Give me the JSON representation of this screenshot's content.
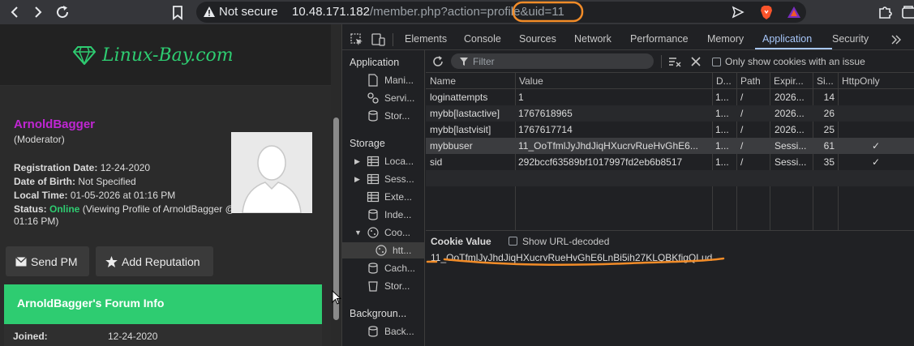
{
  "browser": {
    "not_secure": "Not secure",
    "url_host": "10.48.171.182",
    "url_path": "/member.php?action=profile",
    "url_query": "&uid=11",
    "annotation_color": "#f28c28"
  },
  "site": {
    "logo_text": "Linux-Bay.com",
    "accent": "#2ecc71"
  },
  "profile": {
    "username": "ArnoldBagger",
    "role": "(Moderator)",
    "registration_label": "Registration Date:",
    "registration_value": "12-24-2020",
    "dob_label": "Date of Birth:",
    "dob_value": "Not Specified",
    "localtime_label": "Local Time:",
    "localtime_value": "01-05-2026 at 01:16 PM",
    "status_label": "Status:",
    "status_online": "Online",
    "status_detail_1": "(Viewing Profile of ArnoldBagger @",
    "status_detail_2": "01:16 PM)",
    "send_pm": "Send PM",
    "add_reputation": "Add Reputation",
    "forum_info_title": "ArnoldBagger's Forum Info",
    "joined_label": "Joined:",
    "joined_value": "12-24-2020"
  },
  "devtools": {
    "tabs": [
      "Elements",
      "Console",
      "Sources",
      "Network",
      "Performance",
      "Memory",
      "Application",
      "Security"
    ],
    "active_tab": "Application",
    "sidebar": {
      "application_header": "Application",
      "application_items": [
        "Mani...",
        "Servi...",
        "Stor..."
      ],
      "storage_header": "Storage",
      "storage_items": [
        "Loca...",
        "Sess...",
        "Exte...",
        "Inde...",
        "Coo...",
        "htt...",
        "Cach...",
        "Stor..."
      ],
      "background_header": "Backgroun...",
      "background_items": [
        "Back..."
      ]
    },
    "toolbar": {
      "filter_placeholder": "Filter",
      "issue_label": "Only show cookies with an issue"
    },
    "table": {
      "headers": [
        "Name",
        "Value",
        "D...",
        "Path",
        "Expir...",
        "Si...",
        "HttpOnly"
      ],
      "rows": [
        {
          "name": "loginattempts",
          "value": "1",
          "domain": "1...",
          "path": "/",
          "expires": "2026...",
          "size": "14",
          "httponly": ""
        },
        {
          "name": "mybb[lastactive]",
          "value": "1767618965",
          "domain": "1...",
          "path": "/",
          "expires": "2026...",
          "size": "26",
          "httponly": ""
        },
        {
          "name": "mybb[lastvisit]",
          "value": "1767617714",
          "domain": "1...",
          "path": "/",
          "expires": "2026...",
          "size": "25",
          "httponly": ""
        },
        {
          "name": "mybbuser",
          "value": "11_OoTfmlJyJhdJiqHXucrvRueHvGhE6...",
          "domain": "1...",
          "path": "/",
          "expires": "Sessi...",
          "size": "61",
          "httponly": "✓"
        },
        {
          "name": "sid",
          "value": "292bccf63589bf1017997fd2eb6b8517",
          "domain": "1...",
          "path": "/",
          "expires": "Sessi...",
          "size": "35",
          "httponly": "✓"
        }
      ]
    },
    "cookie_value": {
      "title": "Cookie Value",
      "decoded_label": "Show URL-decoded",
      "value": "11_OoTfmlJyJhdJiqHXucrvRueHvGhE6LnBi5ih27KLQBKfigQLud"
    }
  }
}
